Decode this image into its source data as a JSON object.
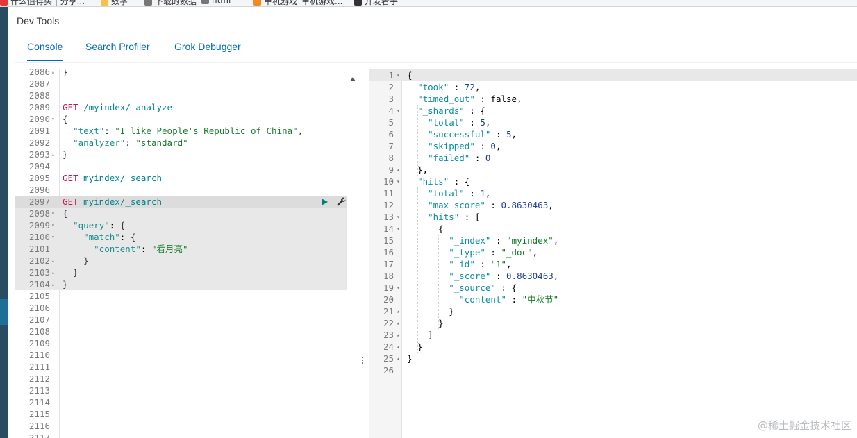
{
  "bookmarks": [
    {
      "label": "什么值得买 | 分享...",
      "icon": "red-circle-icon",
      "color": "#e53935"
    },
    {
      "label": "数字",
      "icon": "folder-icon",
      "color": "#f2c14e"
    },
    {
      "label": "下载的数据",
      "icon": "file-icon",
      "color": "#777777"
    },
    {
      "label": "html",
      "icon": "dot-icon",
      "color": "#777777"
    },
    {
      "label": "单机游戏_单机游戏...",
      "icon": "flame-icon",
      "color": "#f08a24"
    },
    {
      "label": "开发者手",
      "icon": "circle-icon",
      "color": "#333333"
    }
  ],
  "app": {
    "title": "Dev Tools"
  },
  "tabs": [
    {
      "label": "Console",
      "active": true
    },
    {
      "label": "Search Profiler",
      "active": false
    },
    {
      "label": "Grok Debugger",
      "active": false
    }
  ],
  "request_editor": {
    "lines": [
      {
        "num": "2086",
        "fold": "▴",
        "text": "}"
      },
      {
        "num": "2087",
        "fold": "",
        "text": ""
      },
      {
        "num": "2088",
        "fold": "",
        "text": ""
      },
      {
        "num": "2089",
        "fold": "",
        "text": "GET /myindex/_analyze"
      },
      {
        "num": "2090",
        "fold": "▾",
        "text": "{"
      },
      {
        "num": "2091",
        "fold": "",
        "text": "  \"text\": \"I like People's Republic of China\","
      },
      {
        "num": "2092",
        "fold": "",
        "text": "  \"analyzer\": \"standard\""
      },
      {
        "num": "2093",
        "fold": "▴",
        "text": "}"
      },
      {
        "num": "2094",
        "fold": "",
        "text": ""
      },
      {
        "num": "2095",
        "fold": "",
        "text": "GET myindex/_search"
      },
      {
        "num": "2096",
        "fold": "",
        "text": ""
      },
      {
        "num": "2097",
        "fold": "",
        "text": "GET myindex/_search"
      },
      {
        "num": "2098",
        "fold": "▾",
        "text": "{"
      },
      {
        "num": "2099",
        "fold": "▾",
        "text": "  \"query\": {"
      },
      {
        "num": "2100",
        "fold": "▾",
        "text": "    \"match\": {"
      },
      {
        "num": "2101",
        "fold": "",
        "text": "      \"content\": \"看月亮\""
      },
      {
        "num": "2102",
        "fold": "▴",
        "text": "    }"
      },
      {
        "num": "2103",
        "fold": "▴",
        "text": "  }"
      },
      {
        "num": "2104",
        "fold": "▴",
        "text": "}"
      },
      {
        "num": "2105",
        "fold": "",
        "text": ""
      },
      {
        "num": "2106",
        "fold": "",
        "text": ""
      },
      {
        "num": "2107",
        "fold": "",
        "text": ""
      },
      {
        "num": "2108",
        "fold": "",
        "text": ""
      },
      {
        "num": "2109",
        "fold": "",
        "text": ""
      },
      {
        "num": "2110",
        "fold": "",
        "text": ""
      },
      {
        "num": "2111",
        "fold": "",
        "text": ""
      },
      {
        "num": "2112",
        "fold": "",
        "text": ""
      },
      {
        "num": "2113",
        "fold": "",
        "text": ""
      },
      {
        "num": "2114",
        "fold": "",
        "text": ""
      },
      {
        "num": "2115",
        "fold": "",
        "text": ""
      },
      {
        "num": "2116",
        "fold": "",
        "text": ""
      },
      {
        "num": "2117",
        "fold": "",
        "text": ""
      }
    ]
  },
  "response_editor": {
    "lines": [
      {
        "num": "1",
        "fold": "▾",
        "text": "{"
      },
      {
        "num": "2",
        "fold": "",
        "text": "  \"took\" : 72,"
      },
      {
        "num": "3",
        "fold": "",
        "text": "  \"timed_out\" : false,"
      },
      {
        "num": "4",
        "fold": "▾",
        "text": "  \"_shards\" : {"
      },
      {
        "num": "5",
        "fold": "",
        "text": "    \"total\" : 5,"
      },
      {
        "num": "6",
        "fold": "",
        "text": "    \"successful\" : 5,"
      },
      {
        "num": "7",
        "fold": "",
        "text": "    \"skipped\" : 0,"
      },
      {
        "num": "8",
        "fold": "",
        "text": "    \"failed\" : 0"
      },
      {
        "num": "9",
        "fold": "▴",
        "text": "  },"
      },
      {
        "num": "10",
        "fold": "▾",
        "text": "  \"hits\" : {"
      },
      {
        "num": "11",
        "fold": "",
        "text": "    \"total\" : 1,"
      },
      {
        "num": "12",
        "fold": "",
        "text": "    \"max_score\" : 0.8630463,"
      },
      {
        "num": "13",
        "fold": "▾",
        "text": "    \"hits\" : ["
      },
      {
        "num": "14",
        "fold": "▾",
        "text": "      {"
      },
      {
        "num": "15",
        "fold": "",
        "text": "        \"_index\" : \"myindex\","
      },
      {
        "num": "16",
        "fold": "",
        "text": "        \"_type\" : \"_doc\","
      },
      {
        "num": "17",
        "fold": "",
        "text": "        \"_id\" : \"1\","
      },
      {
        "num": "18",
        "fold": "",
        "text": "        \"_score\" : 0.8630463,"
      },
      {
        "num": "19",
        "fold": "▾",
        "text": "        \"_source\" : {"
      },
      {
        "num": "20",
        "fold": "",
        "text": "          \"content\" : \"中秋节\""
      },
      {
        "num": "21",
        "fold": "▴",
        "text": "        }"
      },
      {
        "num": "22",
        "fold": "▴",
        "text": "      }"
      },
      {
        "num": "23",
        "fold": "▴",
        "text": "    ]"
      },
      {
        "num": "24",
        "fold": "▴",
        "text": "  }"
      },
      {
        "num": "25",
        "fold": "▴",
        "text": "}"
      },
      {
        "num": "26",
        "fold": "",
        "text": ""
      }
    ]
  },
  "watermark": "@稀土掘金技术社区",
  "colors": {
    "accent": "#006bb4",
    "rail": "#2a4c63",
    "run_button": "#017d73"
  },
  "icons": {
    "run": "play-icon",
    "wrench": "wrench-icon",
    "scroll_up": "scroll-up-icon",
    "divider": "drag-handle-icon"
  }
}
